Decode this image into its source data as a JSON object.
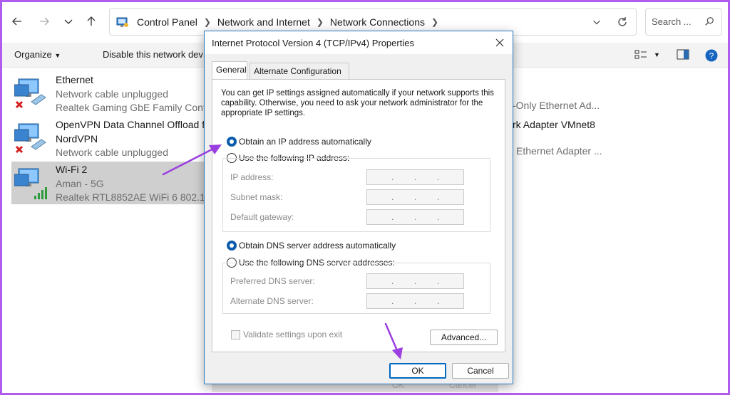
{
  "address": {
    "crumbs": [
      "Control Panel",
      "Network and Internet",
      "Network Connections"
    ],
    "search_placeholder": "Search ..."
  },
  "commandbar": {
    "organize": "Organize",
    "disable": "Disable this network dev"
  },
  "connections": [
    {
      "name": "Ethernet",
      "status": "Network cable unplugged",
      "adapter": "Realtek Gaming GbE Family Contr..."
    },
    {
      "name": "OpenVPN Data Channel Offload for",
      "name2": "NordVPN",
      "status": "Network cable unplugged"
    },
    {
      "name": "Wi-Fi 2",
      "status": "Aman - 5G",
      "adapter": "Realtek RTL8852AE WiFi 6 802.11a..."
    }
  ],
  "right_column": [
    "-Only Ethernet Ad...",
    "rk Adapter VMnet8",
    "Ethernet Adapter ..."
  ],
  "dialog": {
    "title": "Internet Protocol Version 4 (TCP/IPv4) Properties",
    "tabs": [
      "General",
      "Alternate Configuration"
    ],
    "description": "You can get IP settings assigned automatically if your network supports this capability. Otherwise, you need to ask your network administrator for the appropriate IP settings.",
    "ip_auto": "Obtain an IP address automatically",
    "ip_manual": "Use the following IP address:",
    "ip_address_label": "IP address:",
    "subnet_label": "Subnet mask:",
    "gateway_label": "Default gateway:",
    "dns_auto": "Obtain DNS server address automatically",
    "dns_manual": "Use the following DNS server addresses:",
    "preferred_dns_label": "Preferred DNS server:",
    "alternate_dns_label": "Alternate DNS server:",
    "validate_label": "Validate settings upon exit",
    "advanced": "Advanced...",
    "ok": "OK",
    "cancel": "Cancel"
  },
  "behind_buttons": [
    "OK",
    "Cancel"
  ],
  "colors": {
    "accent": "#0067c0",
    "annotation": "#9b3fe0"
  }
}
